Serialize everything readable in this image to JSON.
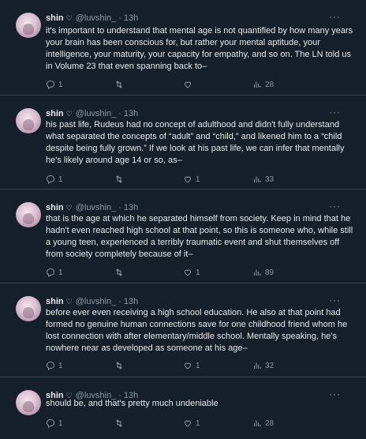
{
  "colors": {
    "background": "#15202b",
    "text": "#e7e9ea",
    "muted": "#8b98a5",
    "divider": "#38444d"
  },
  "icons": {
    "reply": "speech-bubble-icon",
    "retweet": "retweet-icon",
    "like": "heart-icon",
    "views": "bar-chart-icon",
    "more": "ellipsis-icon",
    "verified": "heart-badge-icon"
  },
  "tweets": [
    {
      "name": "shin",
      "handle": "@luvshin_",
      "time": "13h",
      "text": "it's important to understand that mental age is not quantified by how many years your brain has been conscious for, but rather your mental aptitude, your intelligence, your maturity, your capacity for empathy, and so on. The LN told us in Volume 23 that even spanning back to–",
      "replies": "1",
      "retweets": "",
      "likes": "",
      "views": "28"
    },
    {
      "name": "shin",
      "handle": "@luvshin_",
      "time": "13h",
      "text": "his past life, Rudeus had no concept of adulthood and didn't fully understand what separated the concepts of “adult” and “child,” and likened him to a “child despite being fully grown.” If we look at his past life, we can infer that mentally he's likely around age 14 or so, as–",
      "replies": "1",
      "retweets": "",
      "likes": "1",
      "views": "33"
    },
    {
      "name": "shin",
      "handle": "@luvshin_",
      "time": "13h",
      "text": "that is the age at which he separated himself from society. Keep in mind that he hadn't even reached high school at that point, so this is someone who, while still a young teen, experienced a terribly traumatic event and shut themselves off from society completely because of it–",
      "replies": "1",
      "retweets": "",
      "likes": "1",
      "views": "89"
    },
    {
      "name": "shin",
      "handle": "@luvshin_",
      "time": "13h",
      "text": "before ever even receiving a high school education. He also at that point had formed no genuine human connections save for one childhood friend whom he lost connection with after elementary/middle school. Mentally speaking, he's nowhere near as developed as someone at his age–",
      "replies": "1",
      "retweets": "",
      "likes": "1",
      "views": "32"
    },
    {
      "name": "shin",
      "handle": "@luvshin_",
      "time": "13h",
      "text": "should be, and that's pretty much undeniable",
      "replies": "1",
      "retweets": "",
      "likes": "1",
      "views": "28"
    }
  ]
}
